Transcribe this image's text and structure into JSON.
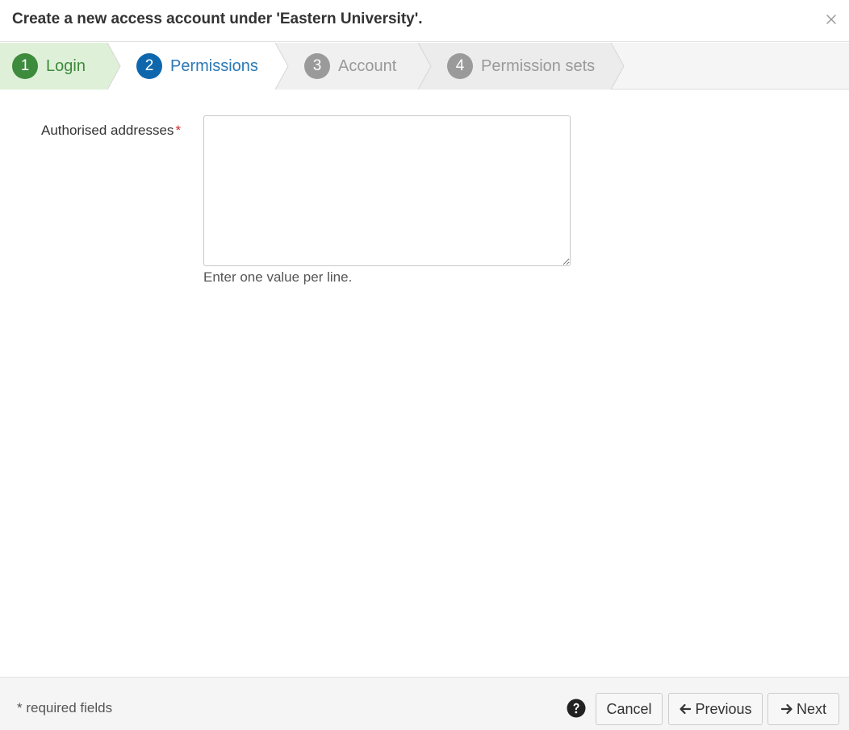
{
  "dialog": {
    "title": "Create a new access account under 'Eastern University'."
  },
  "steps": [
    {
      "number": "1",
      "label": "Login",
      "state": "completed"
    },
    {
      "number": "2",
      "label": "Permissions",
      "state": "current"
    },
    {
      "number": "3",
      "label": "Account",
      "state": "upcoming"
    },
    {
      "number": "4",
      "label": "Permission sets",
      "state": "upcoming"
    }
  ],
  "form": {
    "addresses_label": "Authorised addresses",
    "required_marker": "*",
    "addresses_value": "",
    "addresses_help": "Enter one value per line."
  },
  "footer": {
    "required_note": "* required fields",
    "cancel_label": "Cancel",
    "previous_label": "Previous",
    "next_label": "Next"
  },
  "colors": {
    "completed": "#3d8b3d",
    "completed_bg": "#dff0d8",
    "current": "#0e67ad",
    "upcoming": "#9a9a9a",
    "required": "#c9302c"
  },
  "icons": [
    "close-icon",
    "question-circle-icon",
    "arrow-left-icon",
    "arrow-right-icon"
  ]
}
